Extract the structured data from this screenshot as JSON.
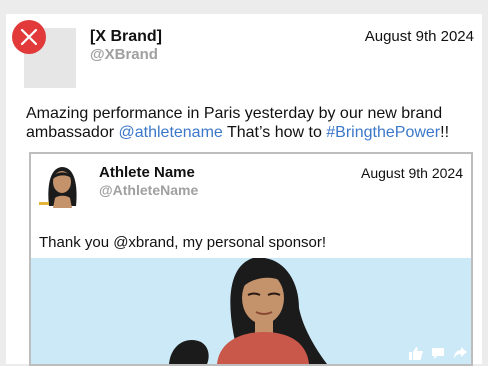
{
  "post": {
    "brand_name": "[X Brand]",
    "brand_handle": "@XBrand",
    "date": "August 9th 2024",
    "text_intro": "Amazing performance in Paris yesterday by our new brand ambassador ",
    "mention": "@athletename",
    "text_middle": " That’s how to ",
    "hashtag": "#BringthePower",
    "text_end": "!!"
  },
  "quoted_post": {
    "author_name": "Athlete Name",
    "author_handle": "@AthleteName",
    "date": "August 9th 2024",
    "text": "Thank you @xbrand, my personal sponsor!"
  },
  "icons": {
    "close": "close-icon",
    "like": "thumbs-up-icon",
    "comment": "comment-icon",
    "share": "share-icon"
  },
  "colors": {
    "close_badge": "#e23a3a",
    "link": "#3b78c9",
    "media_background": "#cbe9f6"
  }
}
